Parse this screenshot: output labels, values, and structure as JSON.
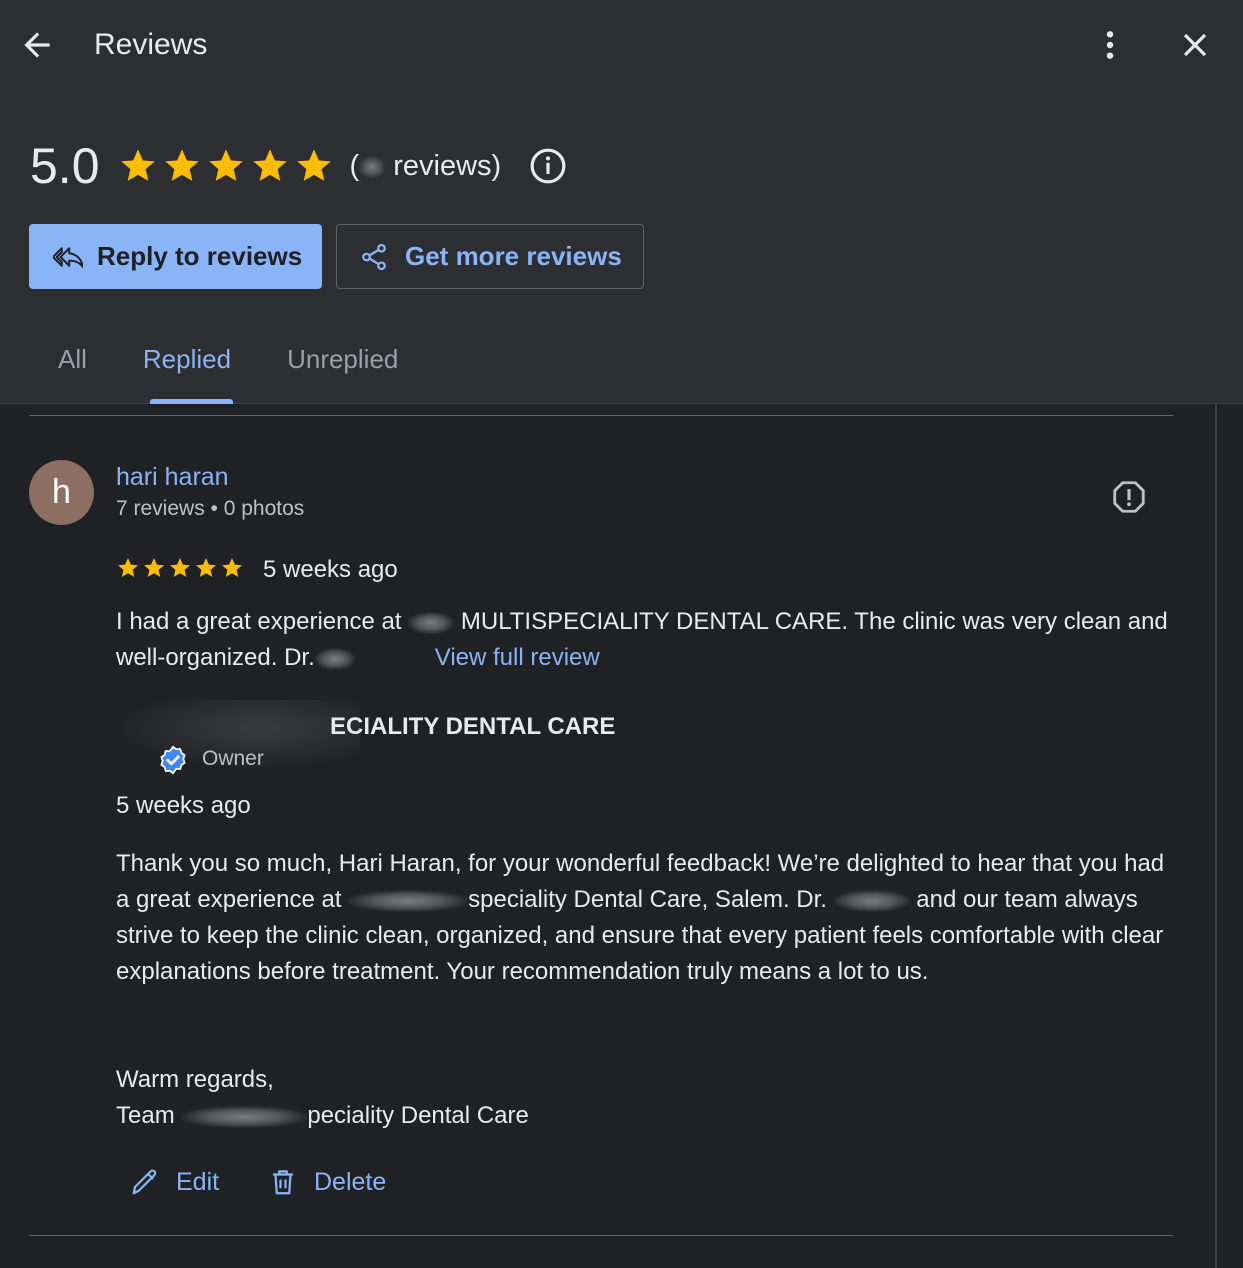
{
  "topbar": {
    "title": "Reviews",
    "back_icon": "arrow-back-icon",
    "more_icon": "more-vert-icon",
    "close_icon": "close-icon"
  },
  "summary": {
    "rating": "5.0",
    "stars": 5,
    "review_count_prefix": "(",
    "review_count_suffix": " reviews)",
    "star_color": "#fbbc04"
  },
  "actions": {
    "reply_label": "Reply to reviews",
    "get_more_label": "Get more reviews"
  },
  "tabs": [
    {
      "label": "All",
      "active": false
    },
    {
      "label": "Replied",
      "active": true
    },
    {
      "label": "Unreplied",
      "active": false
    }
  ],
  "review": {
    "avatar_letter": "h",
    "avatar_color": "#8d6e63",
    "name": "hari haran",
    "meta": "7 reviews • 0 photos",
    "stars": 5,
    "date": "5 weeks ago",
    "text_part1": "I had a great experience at ",
    "text_part2": " MULTISPECIALITY DENTAL CARE. The clinic was very clean and well-organized. Dr.",
    "view_full": "View full review",
    "reply": {
      "owner_name": "ECIALITY DENTAL CARE",
      "owner_role": "Owner",
      "date": "5 weeks ago",
      "text_part1": "Thank you so much, Hari Haran, for your wonderful feedback! We’re delighted to hear that you had a great experience at ",
      "text_part2": "speciality Dental Care, Salem. Dr. ",
      "text_part3": " and our team always strive to keep the clinic clean, organized, and ensure that every patient feels comfortable with clear explanations before treatment. Your recommendation truly means a lot to us.",
      "sign_line1": "Warm regards,",
      "sign_line2_prefix": "Team ",
      "sign_line2_suffix": "peciality Dental Care"
    },
    "edit_label": "Edit",
    "delete_label": "Delete"
  },
  "colors": {
    "accent": "#8ab4f8",
    "background": "#202124",
    "header_bg": "#2d2e31"
  }
}
